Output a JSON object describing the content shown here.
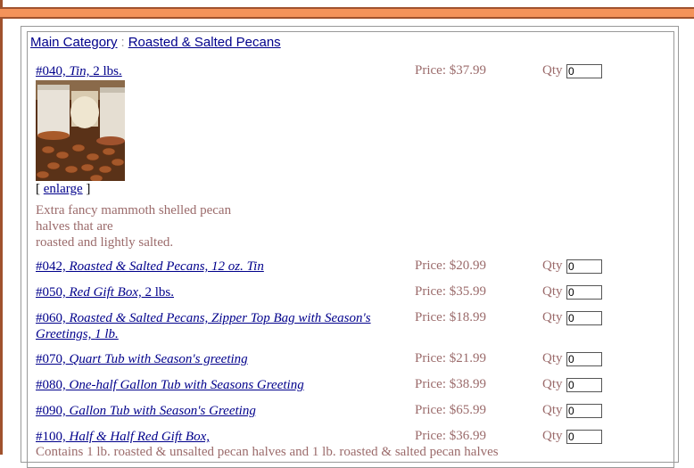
{
  "breadcrumb": {
    "root": "Main Category",
    "sep": ":",
    "current": "Roasted & Salted Pecans"
  },
  "qty_label": "Qty",
  "first_item": {
    "code": "#040,",
    "name": "Tin,",
    "size": "2 lbs.",
    "price": "Price: $37.99",
    "qty": "0",
    "enlarge_open": "[",
    "enlarge_link": "enlarge",
    "enlarge_close": "]",
    "description_lines": [
      "Extra fancy mammoth shelled pecan",
      "halves that are",
      "roasted and lightly salted."
    ]
  },
  "items": [
    {
      "code": "#042,",
      "name": "Roasted & Salted Pecans, 12 oz. Tin",
      "size": "",
      "price": "Price: $20.99",
      "qty": "0"
    },
    {
      "code": "#050,",
      "name": "Red Gift Box,",
      "size": "2 lbs.",
      "price": "Price: $35.99",
      "qty": "0"
    },
    {
      "code": "#060,",
      "name": "Roasted & Salted Pecans, Zipper Top Bag with Season's Greetings,",
      "size": "1 lb.",
      "price": "Price: $18.99",
      "qty": "0"
    },
    {
      "code": "#070,",
      "name": "Quart Tub with Season's greeting",
      "size": "",
      "price": "Price: $21.99",
      "qty": "0"
    },
    {
      "code": "#080,",
      "name": "One-half Gallon Tub with Seasons Greeting",
      "size": "",
      "price": "Price: $38.99",
      "qty": "0"
    },
    {
      "code": "#090,",
      "name": "Gallon Tub with Season's Greeting",
      "size": "",
      "price": "Price: $65.99",
      "qty": "0"
    },
    {
      "code": "#100,",
      "name": "Half & Half Red Gift Box,",
      "size": "",
      "price": "Price: $36.99",
      "qty": "0"
    }
  ],
  "last_description": "Contains 1 lb. roasted & unsalted pecan halves and 1 lb. roasted & salted pecan halves"
}
